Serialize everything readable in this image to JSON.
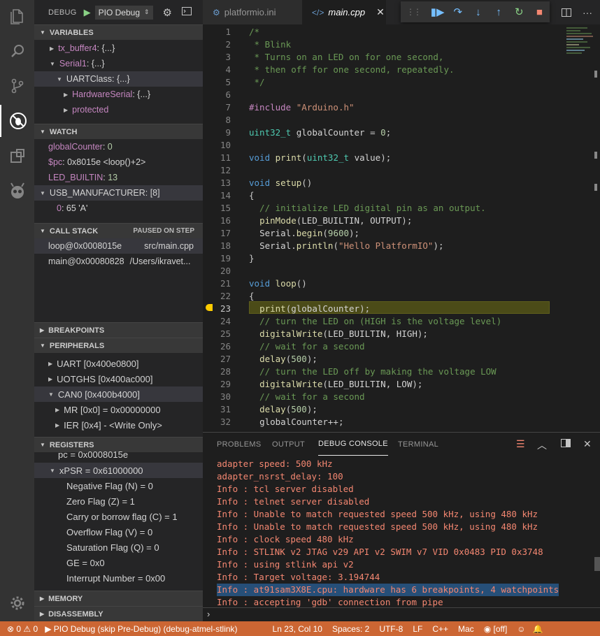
{
  "activity_bar": {
    "items": [
      "files-icon",
      "search-icon",
      "source-control-icon",
      "debug-icon",
      "extensions-icon",
      "platformio-icon"
    ],
    "settings": "gear-icon"
  },
  "debug_toolbar": {
    "title": "DEBUG",
    "config": "PIO Debug"
  },
  "variables": {
    "header": "VARIABLES",
    "rows": [
      {
        "name": "tx_buffer4",
        "value": "{...}"
      },
      {
        "name": "Serial1",
        "value": "{...}"
      },
      {
        "name": "UARTClass",
        "value": "{...}"
      },
      {
        "name": "HardwareSerial",
        "value": "{...}"
      },
      {
        "name": "protected",
        "value": ""
      }
    ]
  },
  "watch": {
    "header": "WATCH",
    "rows": [
      {
        "name": "globalCounter",
        "value": "0"
      },
      {
        "name": "$pc",
        "value": "0x8015e <loop()+2>"
      },
      {
        "name": "LED_BUILTIN",
        "value": "13"
      },
      {
        "name": "USB_MANUFACTURER",
        "value": "[8]"
      },
      {
        "name": "0",
        "value": "65 'A'"
      }
    ]
  },
  "call_stack": {
    "header": "CALL STACK",
    "status": "PAUSED ON STEP",
    "frames": [
      {
        "fn": "loop@0x0008015e",
        "file": "src/main.cpp"
      },
      {
        "fn": "main@0x00080828",
        "file": "/Users/ikravet..."
      }
    ]
  },
  "breakpoints": {
    "header": "BREAKPOINTS"
  },
  "peripherals": {
    "header": "PERIPHERALS",
    "rows": [
      "UART  [0x400e0800]",
      "UOTGHS  [0x400ac000]",
      "CAN0  [0x400b4000]",
      "MR [0x0] = 0x00000000",
      "IER [0x4] - <Write Only>"
    ]
  },
  "registers": {
    "header": "REGISTERS",
    "rows": [
      "pc = 0x0008015e",
      "xPSR = 0x61000000",
      "Negative Flag (N) = 0",
      "Zero Flag (Z) = 1",
      "Carry or borrow flag (C) = 1",
      "Overflow Flag (V) = 0",
      "Saturation Flag (Q) = 0",
      "GE = 0x0",
      "Interrupt Number = 0x00"
    ]
  },
  "memory": {
    "header": "MEMORY"
  },
  "disassembly": {
    "header": "DISASSEMBLY"
  },
  "tabs": [
    {
      "label": "platformio.ini",
      "active": false
    },
    {
      "label": "main.cpp",
      "active": true
    }
  ],
  "editor": {
    "current_line": 23,
    "lines": [
      "/*",
      " * Blink",
      " * Turns on an LED on for one second,",
      " * then off for one second, repeatedly.",
      " */",
      "",
      "#include \"Arduino.h\"",
      "",
      "uint32_t globalCounter = 0;",
      "",
      "void print(uint32_t value);",
      "",
      "void setup()",
      "{",
      "  // initialize LED digital pin as an output.",
      "  pinMode(LED_BUILTIN, OUTPUT);",
      "  Serial.begin(9600);",
      "  Serial.println(\"Hello PlatformIO\");",
      "}",
      "",
      "void loop()",
      "{",
      "  print(globalCounter);",
      "  // turn the LED on (HIGH is the voltage level)",
      "  digitalWrite(LED_BUILTIN, HIGH);",
      "  // wait for a second",
      "  delay(500);",
      "  // turn the LED off by making the voltage LOW",
      "  digitalWrite(LED_BUILTIN, LOW);",
      "  // wait for a second",
      "  delay(500);",
      "  globalCounter++;"
    ]
  },
  "panel": {
    "tabs": [
      "PROBLEMS",
      "OUTPUT",
      "DEBUG CONSOLE",
      "TERMINAL"
    ],
    "active_tab": "DEBUG CONSOLE",
    "console": [
      "adapter speed: 500 kHz",
      "adapter_nsrst_delay: 100",
      "Info : tcl server disabled",
      "Info : telnet server disabled",
      "Info : Unable to match requested speed 500 kHz, using 480 kHz",
      "Info : Unable to match requested speed 500 kHz, using 480 kHz",
      "Info : clock speed 480 kHz",
      "Info : STLINK v2 JTAG v29 API v2 SWIM v7 VID 0x0483 PID 0x3748",
      "Info : using stlink api v2",
      "Info : Target voltage: 3.194744",
      "Info : at91sam3X8E.cpu: hardware has 6 breakpoints, 4 watchpoints",
      "Info : accepting 'gdb' connection from pipe"
    ],
    "selected_line": 10,
    "prompt": "›"
  },
  "status_bar": {
    "errors": "0",
    "warnings": "0",
    "debug_session": "PIO Debug (skip Pre-Debug) (debug-atmel-stlink)",
    "position": "Ln 23, Col 10",
    "spaces": "Spaces: 2",
    "encoding": "UTF-8",
    "eol": "LF",
    "language": "C++",
    "platform": "Mac",
    "watch": "[off]"
  },
  "colors": {
    "statusbar": "#cc6633",
    "debug_highlight": "#4b4b18",
    "console_text": "#f48771"
  }
}
